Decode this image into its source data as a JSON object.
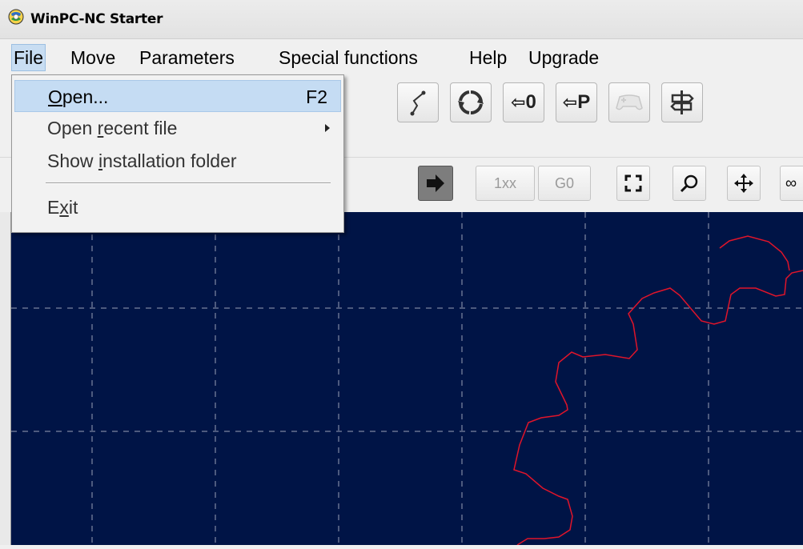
{
  "window": {
    "title": "WinPC-NC Starter",
    "icon": "app-globe-icon"
  },
  "menubar": {
    "items": [
      {
        "label": "File",
        "active": true
      },
      {
        "label": "Move"
      },
      {
        "label": "Parameters"
      },
      {
        "label": "Special functions"
      },
      {
        "label": "Help"
      },
      {
        "label": "Upgrade"
      }
    ]
  },
  "file_menu": {
    "open": {
      "label_mnemonic": "O",
      "label_rest": "pen...",
      "shortcut": "F2"
    },
    "open_recent": {
      "label_pre": "Open ",
      "label_mnemonic": "r",
      "label_rest": "ecent file"
    },
    "show_install": {
      "label_pre": "Show ",
      "label_mnemonic": "i",
      "label_rest": "nstallation folder"
    },
    "exit": {
      "label_pre": "E",
      "label_mnemonic": "x",
      "label_rest": "it"
    }
  },
  "toolbar1": {
    "buttons": [
      {
        "icon": "path-line-icon"
      },
      {
        "icon": "refresh-circle-icon"
      },
      {
        "label": "⇦0",
        "text": "0"
      },
      {
        "label": "⇦P",
        "text": "P"
      },
      {
        "icon": "gamepad-icon",
        "disabled": true
      },
      {
        "icon": "signpost-icon"
      }
    ]
  },
  "toolbar2": {
    "play_icon": "arrow-right-icon",
    "speed_label": "1xx",
    "rapid_label": "G0",
    "view_icons": [
      "fit-view-icon",
      "zoom-icon",
      "pan-move-icon"
    ]
  },
  "colors": {
    "canvas_bg": "#001446",
    "grid": "#9a9fb5",
    "contour": "#e0142a",
    "menu_highlight": "#c5dcf3"
  }
}
